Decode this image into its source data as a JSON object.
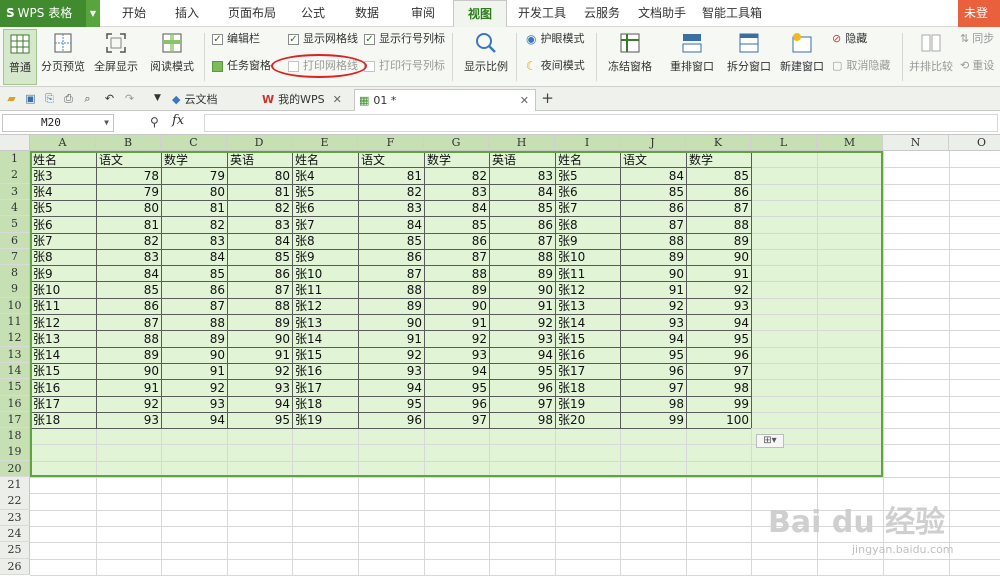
{
  "menubar": {
    "app_name": "WPS 表格",
    "tabs": [
      "开始",
      "插入",
      "页面布局",
      "公式",
      "数据",
      "审阅",
      "视图",
      "开发工具",
      "云服务",
      "文档助手",
      "智能工具箱"
    ],
    "active_tab": "视图",
    "login": "未登"
  },
  "ribbon": {
    "normal": "普通",
    "page_preview": "分页预览",
    "fullscreen": "全屏显示",
    "reading_mode": "阅读模式",
    "edit_bar": "编辑栏",
    "show_gridlines": "显示网格线",
    "show_headers": "显示行号列标",
    "task_pane": "任务窗格",
    "print_gridlines": "打印网格线",
    "print_headers": "打印行号列标",
    "zoom": "显示比例",
    "eye_mode": "护眼模式",
    "night_mode": "夜间模式",
    "freeze": "冻结窗格",
    "arrange": "重排窗口",
    "split": "拆分窗口",
    "new_window": "新建窗口",
    "hide": "隐藏",
    "unhide": "取消隐藏",
    "side_by_side": "并排比较",
    "sync": "同步",
    "reset": "重设"
  },
  "doc_tabs": {
    "tabs": [
      {
        "label": "云文档"
      },
      {
        "label": "我的WPS"
      },
      {
        "label": "01 *"
      }
    ]
  },
  "formula_bar": {
    "cell_ref": "M20",
    "formula": ""
  },
  "sheet": {
    "columns": [
      "A",
      "B",
      "C",
      "D",
      "E",
      "F",
      "G",
      "H",
      "I",
      "J",
      "K",
      "L",
      "M",
      "N",
      "O"
    ],
    "rows": [
      "1",
      "2",
      "3",
      "4",
      "5",
      "6",
      "7",
      "8",
      "9",
      "10",
      "11",
      "12",
      "13",
      "14",
      "15",
      "16",
      "17",
      "18",
      "19",
      "20",
      "21",
      "22",
      "23",
      "24",
      "25",
      "26"
    ],
    "header_row": [
      "姓名",
      "语文",
      "数学",
      "英语",
      "姓名",
      "语文",
      "数学",
      "英语",
      "姓名",
      "语文",
      "数学"
    ],
    "data_rows": [
      [
        "张3",
        "78",
        "79",
        "80",
        "张4",
        "81",
        "82",
        "83",
        "张5",
        "84",
        "85"
      ],
      [
        "张4",
        "79",
        "80",
        "81",
        "张5",
        "82",
        "83",
        "84",
        "张6",
        "85",
        "86"
      ],
      [
        "张5",
        "80",
        "81",
        "82",
        "张6",
        "83",
        "84",
        "85",
        "张7",
        "86",
        "87"
      ],
      [
        "张6",
        "81",
        "82",
        "83",
        "张7",
        "84",
        "85",
        "86",
        "张8",
        "87",
        "88"
      ],
      [
        "张7",
        "82",
        "83",
        "84",
        "张8",
        "85",
        "86",
        "87",
        "张9",
        "88",
        "89"
      ],
      [
        "张8",
        "83",
        "84",
        "85",
        "张9",
        "86",
        "87",
        "88",
        "张10",
        "89",
        "90"
      ],
      [
        "张9",
        "84",
        "85",
        "86",
        "张10",
        "87",
        "88",
        "89",
        "张11",
        "90",
        "91"
      ],
      [
        "张10",
        "85",
        "86",
        "87",
        "张11",
        "88",
        "89",
        "90",
        "张12",
        "91",
        "92"
      ],
      [
        "张11",
        "86",
        "87",
        "88",
        "张12",
        "89",
        "90",
        "91",
        "张13",
        "92",
        "93"
      ],
      [
        "张12",
        "87",
        "88",
        "89",
        "张13",
        "90",
        "91",
        "92",
        "张14",
        "93",
        "94"
      ],
      [
        "张13",
        "88",
        "89",
        "90",
        "张14",
        "91",
        "92",
        "93",
        "张15",
        "94",
        "95"
      ],
      [
        "张14",
        "89",
        "90",
        "91",
        "张15",
        "92",
        "93",
        "94",
        "张16",
        "95",
        "96"
      ],
      [
        "张15",
        "90",
        "91",
        "92",
        "张16",
        "93",
        "94",
        "95",
        "张17",
        "96",
        "97"
      ],
      [
        "张16",
        "91",
        "92",
        "93",
        "张17",
        "94",
        "95",
        "96",
        "张18",
        "97",
        "98"
      ],
      [
        "张17",
        "92",
        "93",
        "94",
        "张18",
        "95",
        "96",
        "97",
        "张19",
        "98",
        "99"
      ],
      [
        "张18",
        "93",
        "94",
        "95",
        "张19",
        "96",
        "97",
        "98",
        "张20",
        "99",
        "100"
      ]
    ]
  },
  "watermark": {
    "main": "Bai du 经验",
    "sub": "jingyan.baidu.com"
  }
}
